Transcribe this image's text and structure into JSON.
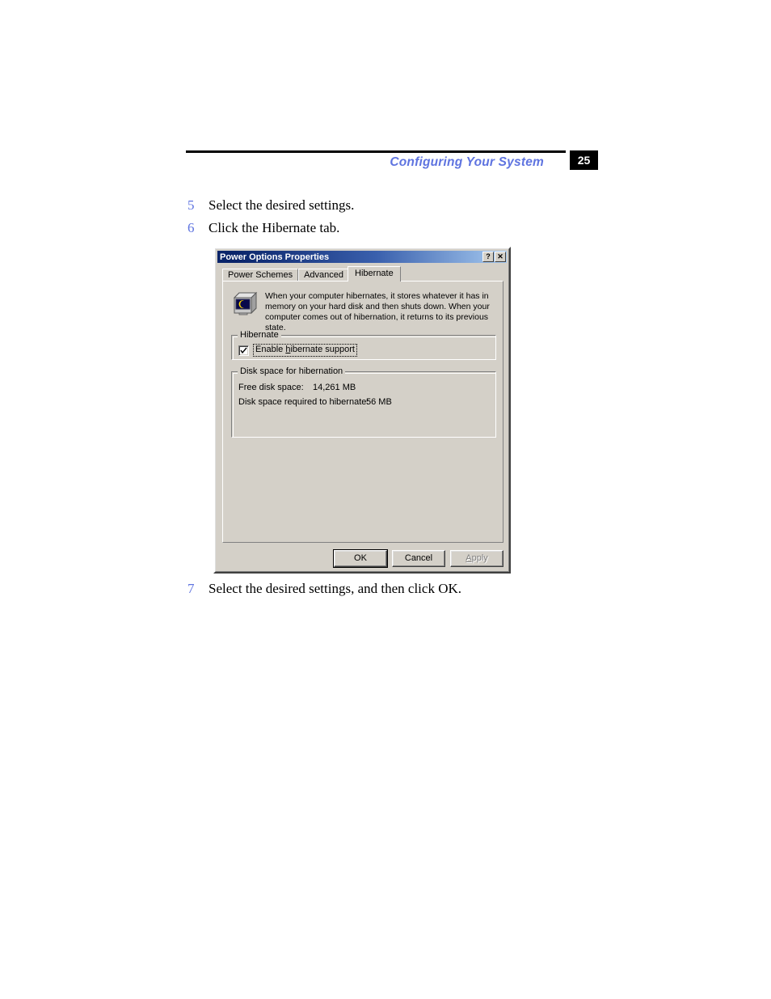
{
  "page": {
    "header_title": "Configuring Your System",
    "page_number": "25"
  },
  "steps": [
    {
      "number": "5",
      "text": "Select the desired settings."
    },
    {
      "number": "6",
      "text": "Click the Hibernate tab."
    },
    {
      "number": "7",
      "text": "Select the desired settings, and then click OK."
    }
  ],
  "dialog": {
    "title": "Power Options Properties",
    "titlebar_buttons": [
      {
        "name": "help-button",
        "glyph": "?"
      },
      {
        "name": "close-button",
        "glyph": "✕"
      }
    ],
    "tabs": [
      {
        "label": "Power Schemes",
        "active": false
      },
      {
        "label": "Advanced",
        "active": false
      },
      {
        "label": "Hibernate",
        "active": true
      }
    ],
    "description": "When your computer hibernates, it stores whatever it has in memory on your hard disk and then shuts down. When your computer comes out of hibernation, it returns to its previous state.",
    "hibernate_group": {
      "title": "Hibernate",
      "checkbox_label_before": "Enable ",
      "checkbox_label_accel": "h",
      "checkbox_label_after": "ibernate support",
      "checkbox_checked": true
    },
    "diskspace_group": {
      "title": "Disk space for hibernation",
      "rows": [
        {
          "label": "Free disk space:",
          "value": "14,261 MB"
        },
        {
          "label": "Disk space required to hibernate:",
          "value": "56 MB"
        }
      ]
    },
    "buttons": [
      {
        "label": "OK",
        "state": "default"
      },
      {
        "label": "Cancel",
        "state": "normal"
      },
      {
        "label": "Apply",
        "state": "disabled",
        "accel": "A",
        "rest": "pply"
      }
    ]
  },
  "colors": {
    "accent_blue": "#5f74e0",
    "badge_bg": "#000000",
    "dialog_face": "#d4d0c8",
    "titlebar_start": "#0a246a",
    "titlebar_end": "#a6caf0",
    "moon_yellow": "#ffd800"
  }
}
